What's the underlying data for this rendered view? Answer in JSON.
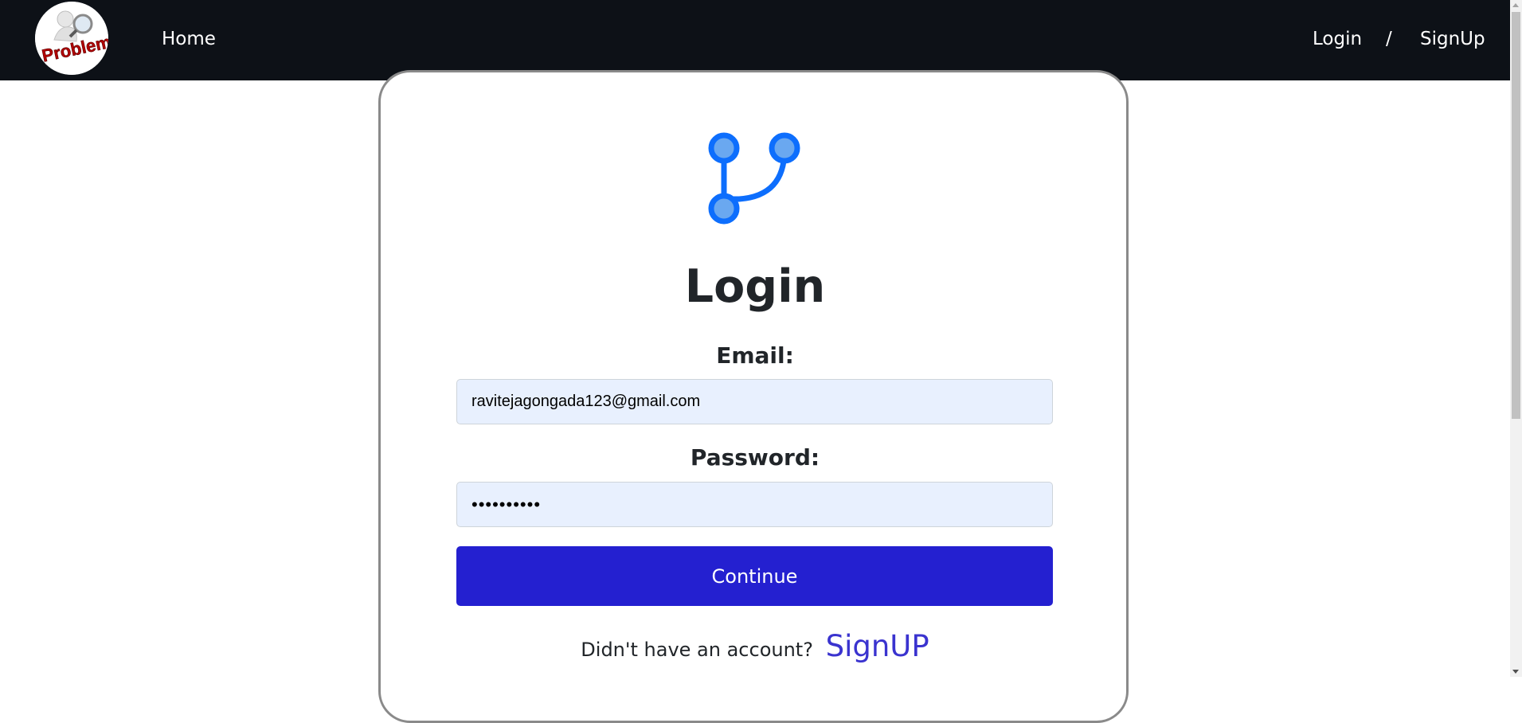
{
  "navbar": {
    "logo_text": "Problem",
    "home_label": "Home",
    "login_label": "Login",
    "separator": "/",
    "signup_label": "SignUp"
  },
  "form": {
    "icon": "git-branch-icon",
    "title": "Login",
    "email_label": "Email:",
    "email_value": "ravitejagongada123@gmail.com",
    "password_label": "Password:",
    "password_value": "••••••••••",
    "continue_label": "Continue",
    "footer_text": "Didn't have an account?",
    "footer_link": "SignUP"
  },
  "colors": {
    "navbar_bg": "#0d1117",
    "button_bg": "#2420d0",
    "input_bg": "#e8f0fe",
    "link": "#3a33cf",
    "icon_blue": "#0d6efd"
  }
}
